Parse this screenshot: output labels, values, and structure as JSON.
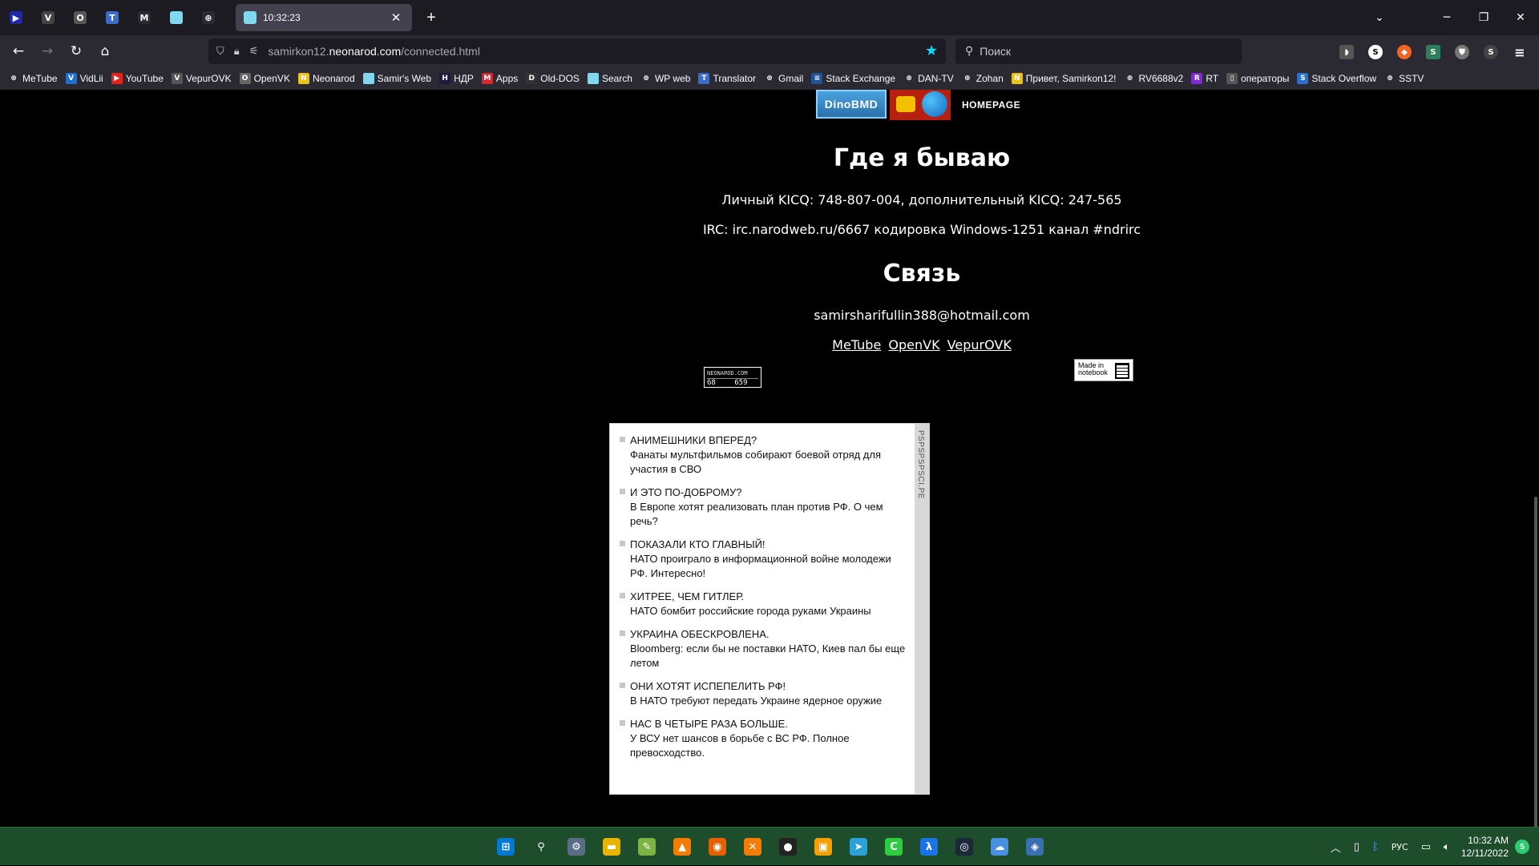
{
  "browser": {
    "active_tab": {
      "title": "10:32:23"
    },
    "pinned_tabs": [
      {
        "name": "metube",
        "color": "#1f2aa8",
        "glyph": "▶"
      },
      {
        "name": "vepurovk",
        "color": "#444",
        "glyph": "V"
      },
      {
        "name": "openvk",
        "color": "#555",
        "glyph": "O"
      },
      {
        "name": "translator",
        "color": "#3b6cc8",
        "glyph": "T"
      },
      {
        "name": "gmail",
        "color": "#2b2a33",
        "glyph": "M"
      },
      {
        "name": "page",
        "color": "#7fd8f0",
        "glyph": ""
      },
      {
        "name": "web",
        "color": "#2b2a33",
        "glyph": "⊕"
      }
    ],
    "url_prefix": "samirkon12.",
    "url_host": "neonarod.com",
    "url_path": "/connected.html",
    "search_placeholder": "Поиск",
    "bookmarks": [
      {
        "label": "MeTube",
        "icon": "globe-icon",
        "color": "#2b2a33",
        "glyph": "⊕"
      },
      {
        "label": "VidLii",
        "icon": "vidlii-icon",
        "color": "#1f6fd1",
        "glyph": "V"
      },
      {
        "label": "YouTube",
        "icon": "youtube-icon",
        "color": "#e62117",
        "glyph": "▶"
      },
      {
        "label": "VepurOVK",
        "icon": "vepurovk-icon",
        "color": "#555",
        "glyph": "V"
      },
      {
        "label": "OpenVK",
        "icon": "openvk-icon",
        "color": "#666",
        "glyph": "O"
      },
      {
        "label": "Neonarod",
        "icon": "neonarod-icon",
        "color": "#e8c21a",
        "glyph": "N"
      },
      {
        "label": "Samir's Web",
        "icon": "page-icon",
        "color": "#7fd8f0",
        "glyph": ""
      },
      {
        "label": "НДР",
        "icon": "ndr-icon",
        "color": "#1a1a3a",
        "glyph": "Н"
      },
      {
        "label": "Apps",
        "icon": "apps-icon",
        "color": "#d8262f",
        "glyph": "M"
      },
      {
        "label": "Old-DOS",
        "icon": "dos-icon",
        "color": "#333",
        "glyph": "D"
      },
      {
        "label": "Search",
        "icon": "page-icon",
        "color": "#7fd8f0",
        "glyph": ""
      },
      {
        "label": "WP web",
        "icon": "globe-icon",
        "color": "#2b2a33",
        "glyph": "⊕"
      },
      {
        "label": "Translator",
        "icon": "translator-icon",
        "color": "#3b6cc8",
        "glyph": "T"
      },
      {
        "label": "Gmail",
        "icon": "globe-icon",
        "color": "#2b2a33",
        "glyph": "⊕"
      },
      {
        "label": "Stack Exchange",
        "icon": "stackexchange-icon",
        "color": "#1e5397",
        "glyph": "≡"
      },
      {
        "label": "DAN-TV",
        "icon": "globe-icon",
        "color": "#2b2a33",
        "glyph": "⊕"
      },
      {
        "label": "Zohan",
        "icon": "globe-icon",
        "color": "#2b2a33",
        "glyph": "⊕"
      },
      {
        "label": "Привет, Samirkon12!",
        "icon": "neonarod-icon",
        "color": "#e8c21a",
        "glyph": "N"
      },
      {
        "label": "RV6688v2",
        "icon": "globe-icon",
        "color": "#2b2a33",
        "glyph": "⊕"
      },
      {
        "label": "RT",
        "icon": "rt-icon",
        "color": "#7b2bd1",
        "glyph": "R"
      },
      {
        "label": "операторы",
        "icon": "doc-icon",
        "color": "#555",
        "glyph": "▯"
      },
      {
        "label": "Stack Overflow",
        "icon": "stackoverflow-icon",
        "color": "#2b6fd1",
        "glyph": "S"
      },
      {
        "label": "SSTV",
        "icon": "globe-icon",
        "color": "#2b2a33",
        "glyph": "⊕"
      }
    ]
  },
  "page": {
    "dino_button": "DinoBMD",
    "homepage_link": "HOMEPAGE",
    "where_title": "Где я бываю",
    "icq_line": "Личный KICQ: 748-807-004, дополнительный KICQ: 247-565",
    "irc_line": "IRC: irc.narodweb.ru/6667 кодировка Windows-1251 канал #ndrirc",
    "contact_title": "Связь",
    "email": "samirsharifullin388@hotmail.com",
    "links": [
      "MeTube",
      "OpenVK",
      "VepurOVK"
    ],
    "counter": {
      "site": "NEONAROD.COM",
      "left": "68",
      "right": "659"
    },
    "made_in": {
      "line1": "Made in",
      "line2": "notebook"
    }
  },
  "news_widget": {
    "side_label": "PSPSPSPSCI.PE",
    "items": [
      {
        "headline": "АНИМЕШНИКИ ВПЕРЕД?",
        "text": "Фанаты мультфильмов собирают боевой отряд для участия в СВО"
      },
      {
        "headline": "И ЭТО ПО-ДОБРОМУ?",
        "text": "В Европе хотят реализовать план против РФ. О чем речь?"
      },
      {
        "headline": "ПОКАЗАЛИ КТО ГЛАВНЫЙ!",
        "text": "НАТО проиграло в информационной войне молодежи РФ. Интересно!"
      },
      {
        "headline": "ХИТРЕЕ, ЧЕМ ГИТЛЕР.",
        "text": "НАТО бомбит российские города руками Украины"
      },
      {
        "headline": "УКРАИНА ОБЕСКРОВЛЕНА.",
        "text": "Bloomberg: если бы не поставки НАТО, Киев пал бы еще летом"
      },
      {
        "headline": "ОНИ ХОТЯТ ИСПЕПЕЛИТЬ РФ!",
        "text": "В НАТО требуют передать Украине ядерное оружие"
      },
      {
        "headline": "НАС В ЧЕТЫРЕ РАЗА БОЛЬШЕ.",
        "text": "У ВСУ нет шансов в борьбе с ВС РФ. Полное превосходство."
      }
    ]
  },
  "taskbar": {
    "apps": [
      {
        "name": "start-button",
        "bg": "#0078d4",
        "glyph": "⊞"
      },
      {
        "name": "search-icon",
        "bg": "transparent",
        "glyph": "⚲"
      },
      {
        "name": "settings-icon",
        "bg": "#5a6d86",
        "glyph": "⚙"
      },
      {
        "name": "file-explorer-icon",
        "bg": "#e8b400",
        "glyph": "▬"
      },
      {
        "name": "notepad-icon",
        "bg": "#7cb342",
        "glyph": "✎"
      },
      {
        "name": "vlc-icon",
        "bg": "#f57c00",
        "glyph": "▲"
      },
      {
        "name": "firefox-icon",
        "bg": "#e66000",
        "glyph": "◉"
      },
      {
        "name": "xampp-icon",
        "bg": "#f57c00",
        "glyph": "✕"
      },
      {
        "name": "obs-icon",
        "bg": "#222",
        "glyph": "●"
      },
      {
        "name": "virtual-desktop-icon",
        "bg": "#f5a000",
        "glyph": "▣"
      },
      {
        "name": "telegram-icon",
        "bg": "#2aa1d8",
        "glyph": "➤"
      },
      {
        "name": "app-c-icon",
        "bg": "#2ecc40",
        "glyph": "C"
      },
      {
        "name": "lambda-icon",
        "bg": "#1a73e8",
        "glyph": "λ"
      },
      {
        "name": "steam-icon",
        "bg": "#1b2838",
        "glyph": "◎"
      },
      {
        "name": "cloud-app-icon",
        "bg": "#4a90e2",
        "glyph": "☁"
      },
      {
        "name": "virtualbox-icon",
        "bg": "#3a6fb0",
        "glyph": "◈"
      }
    ],
    "language": "РУС",
    "time": "10:32 AM",
    "date": "12/11/2022",
    "notification_count": "5"
  }
}
